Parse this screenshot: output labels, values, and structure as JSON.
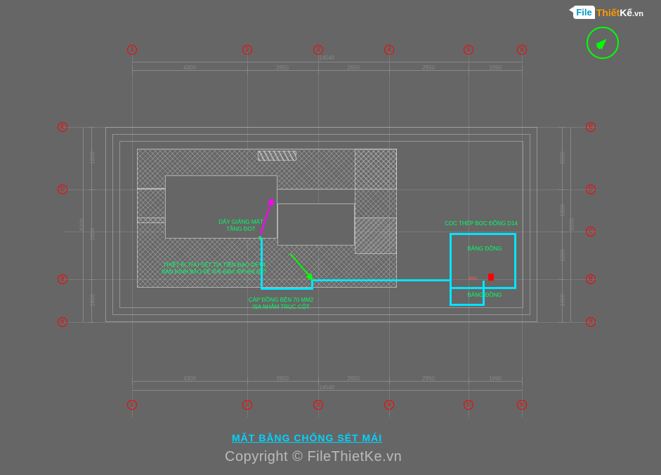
{
  "logo": {
    "box": "File",
    "t1": "Thiết",
    "t2": "Kế",
    "t3": ".vn"
  },
  "watermark": "Copyright © FileThietKe.vn",
  "title": "MẶT BẰNG CHỐNG SÉT MÁI",
  "grid": {
    "cols": [
      "1",
      "2",
      "3",
      "4",
      "5",
      "6"
    ],
    "rows": [
      "A",
      "B",
      "C",
      "D",
      "E"
    ]
  },
  "dims_top": {
    "overall": "14540",
    "segs": [
      "4300",
      "2650",
      "2650",
      "2950",
      "1990"
    ]
  },
  "dims_bottom": {
    "overall": "14540",
    "segs": [
      "4300",
      "2650",
      "2650",
      "2950",
      "1990"
    ]
  },
  "dims_left": {
    "overall": "6200",
    "segs": [
      "1800",
      "2600",
      "1800"
    ]
  },
  "dims_right": {
    "overall": "6200",
    "segs": [
      "2600",
      "1800",
      "1800",
      "1800"
    ]
  },
  "annotations": {
    "a1": "DÂY GIĂNG MẶT\nTẦNG ĐOT",
    "a2": "THIẾT BỊ THU SÉT TIA TIÊN ĐẠO OFT4\nBÁN KÍNH BẢO VỆ R/K 63M; RP=69.3OT",
    "a3": "CÁP ĐỒNG BỆN 70 MM2\nISA NHẮM TRỤC CỘT",
    "a4": "CỌC THÉP BỌC ĐỒNG D14",
    "a5": "BĂNG ĐỒNG",
    "a6": "BĂNG ĐỒNG",
    "a7": "480"
  },
  "chart_data": {
    "type": "plan",
    "grid_x": {
      "labels": [
        "1",
        "2",
        "3",
        "4",
        "5",
        "6"
      ],
      "spacing_mm": [
        4300,
        2650,
        2650,
        2950,
        1990
      ],
      "total_mm": 14540
    },
    "grid_y": {
      "labels": [
        "A",
        "B",
        "C",
        "D",
        "E"
      ],
      "spacing_mm": [
        1800,
        2600,
        1800
      ],
      "total_mm": 6200
    },
    "elements": [
      {
        "name": "lightning-rod",
        "grid": "near 2-3/C"
      },
      {
        "name": "copper-cable-70mm2",
        "route": "from rod down column to ground pit"
      },
      {
        "name": "ground-pit",
        "grid": "5-6/B-C",
        "rods": "D14 copper-clad",
        "strap": "copper band"
      }
    ],
    "title": "MẶT BẰNG CHỐNG SÉT MÁI"
  }
}
